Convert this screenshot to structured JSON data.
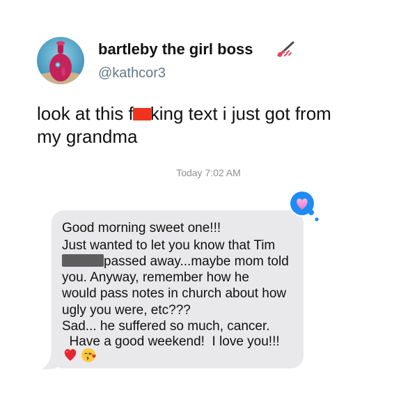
{
  "tweet": {
    "display_name": "bartleby the girl boss",
    "handle": "@kathcor3",
    "avatar_icon": "pink-submarine-avatar-icon",
    "name_emoji_icon": "nail-polish-icon",
    "text_part1": "look at this f",
    "text_redacted_icon": "red-censor-bar",
    "text_part2": "king text i just got from",
    "text_line2": "my grandma"
  },
  "conversation": {
    "timestamp": "Today 7:02 AM",
    "tapback_icon": "heart-tapback-icon",
    "message": {
      "line1": "Good morning sweet one!!!",
      "line2": "Just wanted to let you know that Tim",
      "line3": "passed away...maybe mom told",
      "line4": "you.  Anyway, remember how he",
      "line5": "would pass notes in church about how",
      "line6": "ugly you were, etc???",
      "line7": "Sad... he suffered so much, cancer.",
      "line8": "  Have a good weekend!  I love you!!!",
      "emojis": [
        "red-heart-icon",
        "face-blowing-kiss-icon"
      ]
    },
    "colors": {
      "bubble": "#e9e9eb",
      "tapback": "#1e8cf5",
      "timestamp": "#8e8e93"
    }
  }
}
